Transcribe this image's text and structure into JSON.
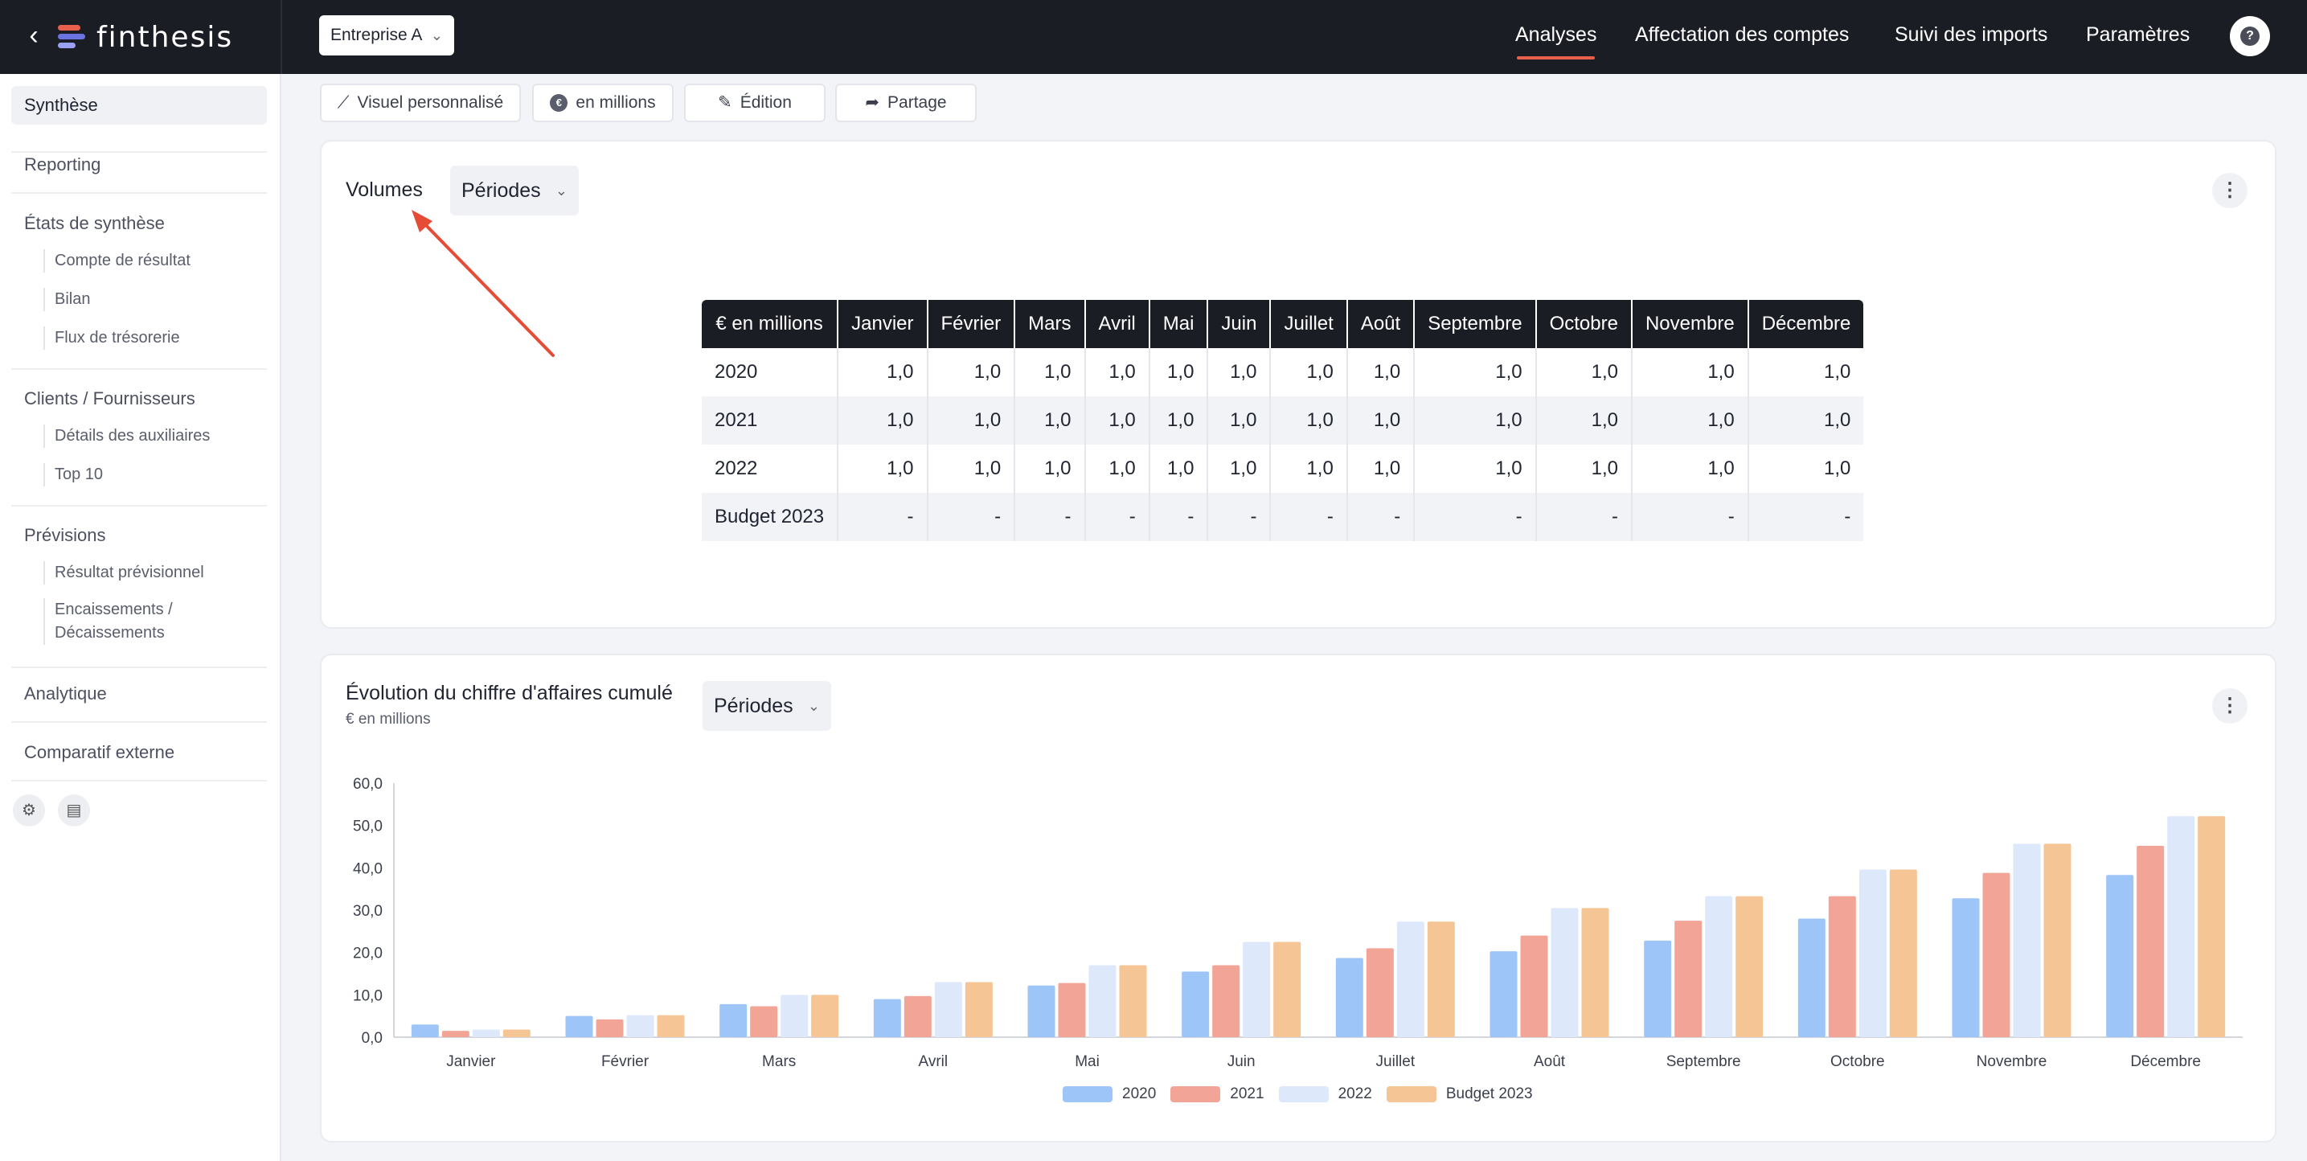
{
  "app": {
    "brand": "finthesis",
    "company": "Entreprise A"
  },
  "nav": [
    {
      "label": "Analyses",
      "active": true
    },
    {
      "label": "Affectation des comptes"
    },
    {
      "label": "Suivi des imports"
    },
    {
      "label": "Paramètres"
    }
  ],
  "sidebar": {
    "synthese": "Synthèse",
    "reporting": "Reporting",
    "etats": "États de synthèse",
    "etats_items": [
      "Compte de résultat",
      "Bilan",
      "Flux de trésorerie"
    ],
    "clients": "Clients / Fournisseurs",
    "clients_items": [
      "Détails des auxiliaires",
      "Top 10"
    ],
    "previsions": "Prévisions",
    "previsions_items": [
      "Résultat prévisionnel",
      "Encaissements /",
      "Décaissements"
    ],
    "analytique": "Analytique",
    "comparatif": "Comparatif externe"
  },
  "toolbar": {
    "visuel": "Visuel personnalisé",
    "millions": "en millions",
    "edition": "Édition",
    "partage": "Partage"
  },
  "volumes": {
    "title": "Volumes",
    "periodes": "Périodes",
    "headers": [
      "€ en millions",
      "Janvier",
      "Février",
      "Mars",
      "Avril",
      "Mai",
      "Juin",
      "Juillet",
      "Août",
      "Septembre",
      "Octobre",
      "Novembre",
      "Décembre"
    ],
    "rows": [
      [
        "2020",
        "1,0",
        "1,0",
        "1,0",
        "1,0",
        "1,0",
        "1,0",
        "1,0",
        "1,0",
        "1,0",
        "1,0",
        "1,0",
        "1,0"
      ],
      [
        "2021",
        "1,0",
        "1,0",
        "1,0",
        "1,0",
        "1,0",
        "1,0",
        "1,0",
        "1,0",
        "1,0",
        "1,0",
        "1,0",
        "1,0"
      ],
      [
        "2022",
        "1,0",
        "1,0",
        "1,0",
        "1,0",
        "1,0",
        "1,0",
        "1,0",
        "1,0",
        "1,0",
        "1,0",
        "1,0",
        "1,0"
      ],
      [
        "Budget 2023",
        "-",
        "-",
        "-",
        "-",
        "-",
        "-",
        "-",
        "-",
        "-",
        "-",
        "-",
        "-"
      ]
    ]
  },
  "evolution": {
    "title": "Évolution du chiffre d'affaires cumulé",
    "subtitle": "€ en millions",
    "periodes": "Périodes"
  },
  "chart_data": {
    "type": "bar",
    "categories": [
      "Janvier",
      "Février",
      "Mars",
      "Avril",
      "Mai",
      "Juin",
      "Juillet",
      "Août",
      "Septembre",
      "Octobre",
      "Novembre",
      "Décembre"
    ],
    "ylim": [
      0,
      60
    ],
    "yticks": [
      "0,0",
      "10,0",
      "20,0",
      "30,0",
      "40,0",
      "50,0",
      "60,0"
    ],
    "grid": false,
    "legend_position": "bottom",
    "series": [
      {
        "name": "2020",
        "color": "#9ec5f8",
        "values": [
          3.0,
          5.0,
          7.8,
          9.0,
          12.2,
          15.5,
          18.7,
          20.3,
          22.8,
          28.0,
          32.8,
          38.3
        ]
      },
      {
        "name": "2021",
        "color": "#f2a597",
        "values": [
          1.5,
          4.2,
          7.3,
          9.7,
          12.8,
          17.0,
          21.0,
          24.0,
          27.5,
          33.3,
          38.8,
          45.2
        ]
      },
      {
        "name": "2022",
        "color": "#dde9fb",
        "values": [
          1.8,
          5.2,
          10.0,
          13.0,
          17.0,
          22.5,
          27.3,
          30.5,
          33.3,
          39.6,
          45.7,
          52.2
        ]
      },
      {
        "name": "Budget 2023",
        "color": "#f6c595",
        "values": [
          1.8,
          5.2,
          10.0,
          13.0,
          17.0,
          22.5,
          27.3,
          30.5,
          33.3,
          39.6,
          45.7,
          52.2
        ]
      }
    ]
  },
  "icons": {
    "back": "chevron-left-icon",
    "help": "question-icon",
    "settings": "gear-icon",
    "document": "document-icon"
  }
}
